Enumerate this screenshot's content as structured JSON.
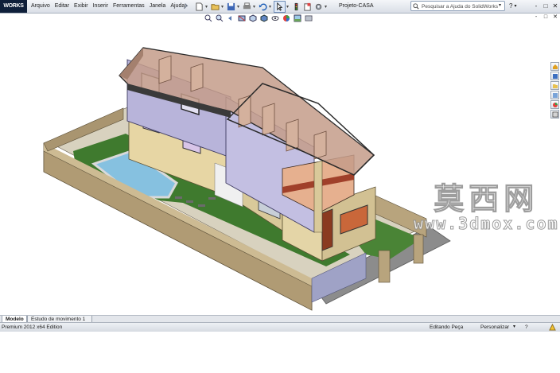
{
  "app": {
    "logo_text": "WORKS",
    "document_title": "Projeto-CASA"
  },
  "menu": {
    "items": [
      "Arquivo",
      "Editar",
      "Exibir",
      "Inserir",
      "Ferramentas",
      "Janela",
      "Ajuda"
    ]
  },
  "quick_access": {
    "icons": [
      "new-icon",
      "open-icon",
      "save-icon",
      "print-icon",
      "undo-icon",
      "select-icon",
      "rebuild-icon",
      "file-properties-icon",
      "options-icon"
    ]
  },
  "search": {
    "placeholder": "Pesquisar a Ajuda do SolidWorks"
  },
  "help_icons": [
    "?",
    "-",
    "□",
    "✕"
  ],
  "heads_up_toolbar": {
    "icons": [
      "zoom-to-fit-icon",
      "zoom-area-icon",
      "previous-view-icon",
      "section-view-icon",
      "view-orientation-icon",
      "display-style-icon",
      "hide-show-icon",
      "edit-appearance-icon",
      "apply-scene-icon",
      "view-settings-icon"
    ]
  },
  "task_pane": {
    "icons": [
      "home-icon",
      "design-library-icon",
      "file-explorer-icon",
      "view-palette-icon",
      "appearances-icon",
      "custom-properties-icon"
    ]
  },
  "watermark": {
    "chinese": "莫西网",
    "url": "www.3dmox.com"
  },
  "tabs": [
    {
      "label": "Modelo",
      "active": true
    },
    {
      "label": "Estudo de movimento 1",
      "active": false
    }
  ],
  "status": {
    "edition": "Premium 2012 x64 Edition",
    "mode": "Editando Peça",
    "customize": "Personalizar"
  },
  "colors": {
    "wall": "#b9a57e",
    "grass": "#3f7a2e",
    "pool": "#7fb8d8",
    "facade": "#b8b4da",
    "roof_glass": "#c49c8a",
    "paving": "#8a8a8a"
  }
}
